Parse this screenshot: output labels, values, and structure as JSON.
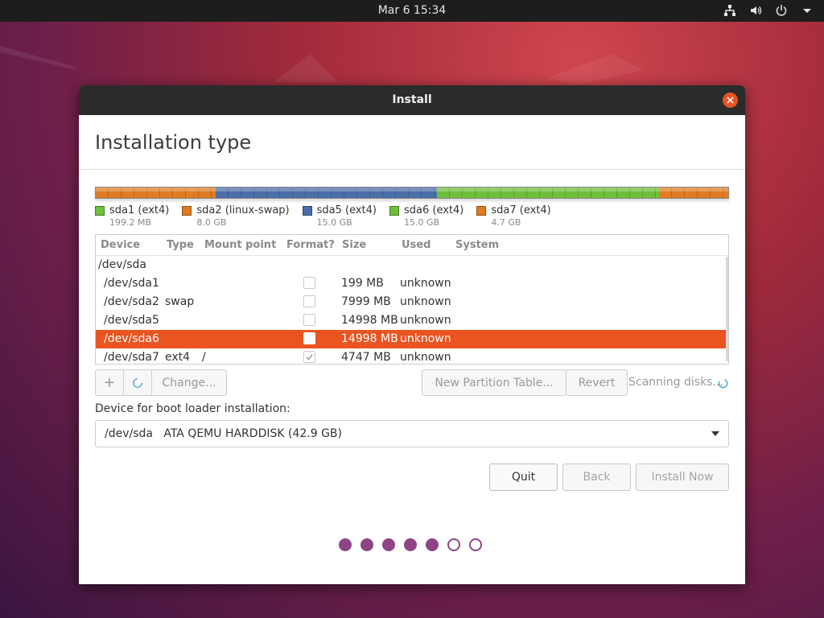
{
  "topbar": {
    "clock": "Mar 6  15:34",
    "icons": [
      "network-icon",
      "volume-icon",
      "power-icon",
      "menu-arrow-icon"
    ]
  },
  "window": {
    "title": "Install",
    "heading": "Installation type"
  },
  "partition_bar": {
    "segments": [
      {
        "name": "sda1",
        "color": "#e07b22",
        "fraction": 0.19
      },
      {
        "name": "sda2",
        "color": "#4a6ea8",
        "fraction": 0.35
      },
      {
        "name": "sda6",
        "color": "#6fbf3a",
        "fraction": 0.35
      },
      {
        "name": "sda7",
        "color": "#e07b22",
        "fraction": 0.11
      }
    ]
  },
  "legend": [
    {
      "name": "sda1 (ext4)",
      "size": "199.2 MB",
      "color": "#6fbf3a"
    },
    {
      "name": "sda2 (linux-swap)",
      "size": "8.0 GB",
      "color": "#e07b22"
    },
    {
      "name": "sda5 (ext4)",
      "size": "15.0 GB",
      "color": "#4a6ea8"
    },
    {
      "name": "sda6 (ext4)",
      "size": "15.0 GB",
      "color": "#6fbf3a"
    },
    {
      "name": "sda7 (ext4)",
      "size": "4.7 GB",
      "color": "#e07b22"
    }
  ],
  "table": {
    "headers": {
      "device": "Device",
      "type": "Type",
      "mount": "Mount point",
      "format": "Format?",
      "size": "Size",
      "used": "Used",
      "system": "System"
    },
    "disk": "/dev/sda",
    "rows": [
      {
        "device": "/dev/sda1",
        "type": "",
        "mount": "",
        "format": false,
        "size": "199 MB",
        "used": "unknown"
      },
      {
        "device": "/dev/sda2",
        "type": "swap",
        "mount": "",
        "format": false,
        "size": "7999 MB",
        "used": "unknown"
      },
      {
        "device": "/dev/sda5",
        "type": "",
        "mount": "",
        "format": false,
        "size": "14998 MB",
        "used": "unknown"
      },
      {
        "device": "/dev/sda6",
        "type": "",
        "mount": "",
        "format": false,
        "size": "14998 MB",
        "used": "unknown",
        "selected": true
      },
      {
        "device": "/dev/sda7",
        "type": "ext4",
        "mount": "/",
        "format": true,
        "size": "4747 MB",
        "used": "unknown"
      }
    ]
  },
  "toolbar": {
    "add": "+",
    "change": "Change...",
    "new_table": "New Partition Table...",
    "revert": "Revert",
    "scanning": "Scanning disks..."
  },
  "bootloader": {
    "label": "Device for boot loader installation:",
    "value": "/dev/sda   ATA QEMU HARDDISK (42.9 GB)"
  },
  "buttons": {
    "quit": "Quit",
    "back": "Back",
    "install": "Install Now"
  },
  "progress": {
    "total": 7,
    "completed": 5
  },
  "colors": {
    "accent": "#e95420",
    "dots": "#8e4585"
  }
}
